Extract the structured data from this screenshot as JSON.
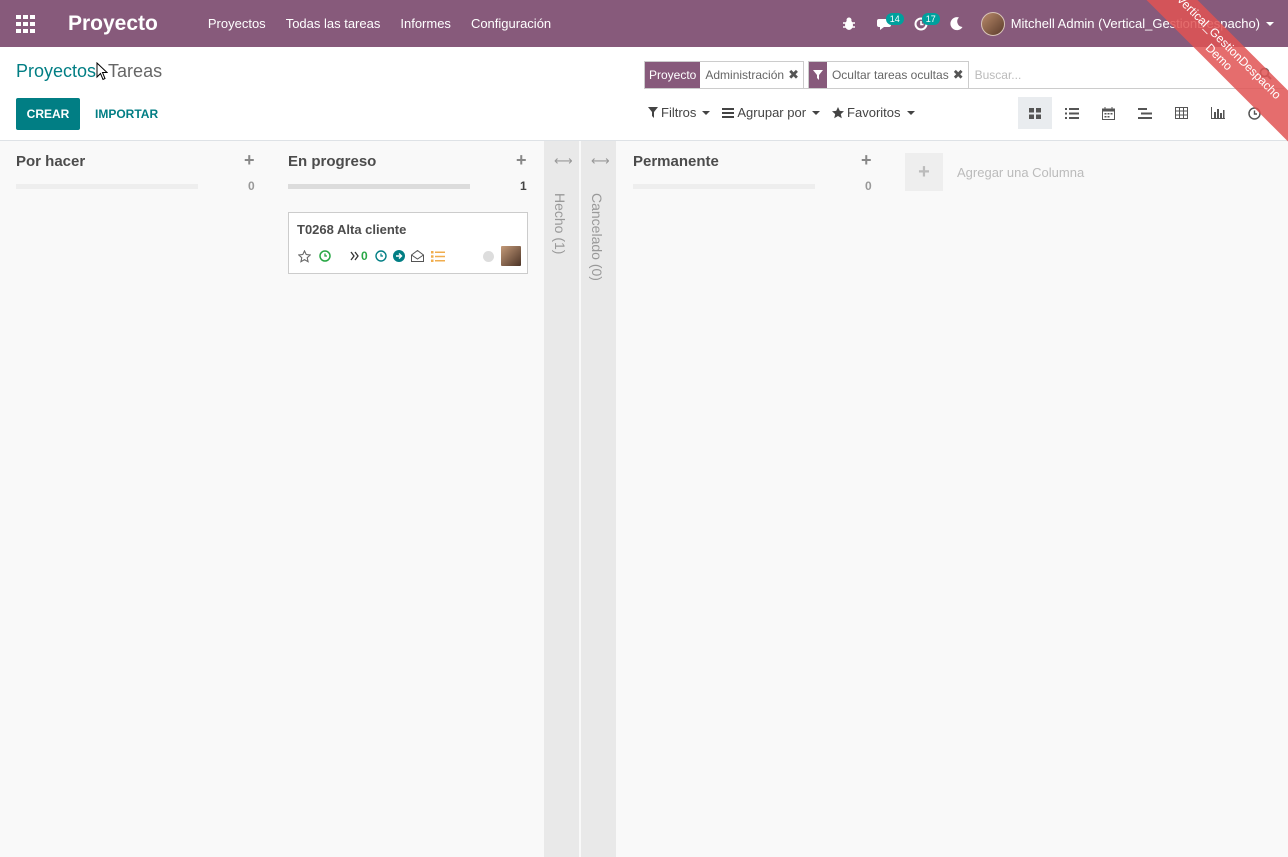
{
  "navbar": {
    "app_name": "Proyecto",
    "menu": [
      "Proyectos",
      "Todas las tareas",
      "Informes",
      "Configuración"
    ],
    "messages_count": "14",
    "activities_count": "17",
    "user_name": "Mitchell Admin (Vertical_GestionDespacho)",
    "bg_color": "#875a7b"
  },
  "ribbon": {
    "line1": "Vertical_GestionDespacho",
    "line2": "Demo"
  },
  "breadcrumb": {
    "parent": "Proyectos",
    "current": "Tareas"
  },
  "actions": {
    "create": "CREAR",
    "import": "IMPORTAR"
  },
  "search": {
    "facets": [
      {
        "label": "Proyecto",
        "value": "Administración"
      },
      {
        "icon": "filter-icon",
        "value": "Ocultar tareas ocultas"
      }
    ],
    "placeholder": "Buscar..."
  },
  "filters": {
    "filters": "Filtros",
    "group_by": "Agrupar por",
    "favorites": "Favoritos"
  },
  "views": [
    "kanban-view-icon",
    "list-view-icon",
    "calendar-view-icon",
    "gantt-view-icon",
    "pivot-view-icon",
    "graph-view-icon",
    "activity-view-icon"
  ],
  "kanban": {
    "columns": [
      {
        "title": "Por hacer",
        "count": "0"
      },
      {
        "title": "En progreso",
        "count": "1"
      },
      {
        "title": "Permanente",
        "count": "0"
      }
    ],
    "folded": [
      {
        "label": "Hecho (1)"
      },
      {
        "label": "Cancelado (0)"
      }
    ],
    "card": {
      "title": "T0268 Alta cliente",
      "subtask_count": "0"
    },
    "add_column": "Agregar una Columna"
  },
  "colors": {
    "accent": "#017e84",
    "brand": "#875a7b",
    "badge": "#00a09d",
    "green_icon": "#28a745",
    "orange_icon": "#f0ad4e"
  }
}
